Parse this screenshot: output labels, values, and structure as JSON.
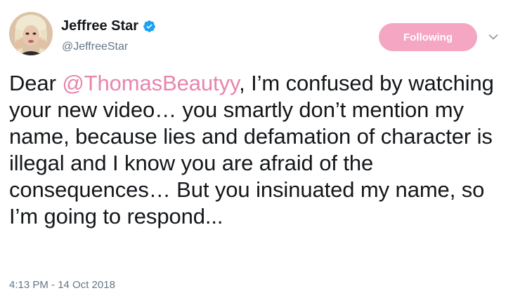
{
  "user": {
    "display_name": "Jeffree Star",
    "handle": "@JeffreeStar",
    "verified": true,
    "avatar_icon": "avatar"
  },
  "follow_button": {
    "label": "Following",
    "color": "#f4a6c2"
  },
  "menu": {
    "icon": "chevron-down-icon"
  },
  "tweet": {
    "text_before": "Dear ",
    "mention": "@ThomasBeautyy",
    "text_after": ", I’m confused by watching your new video… you smartly don’t mention my name, because lies and defamation of character is illegal and I know you are afraid of the consequences… But you insinuated my name, so I’m going to respond...",
    "mention_color": "#e885ad"
  },
  "timestamp": "4:13 PM - 14 Oct 2018",
  "colors": {
    "text": "#14171a",
    "secondary": "#657786",
    "verified": "#1da1f2"
  }
}
